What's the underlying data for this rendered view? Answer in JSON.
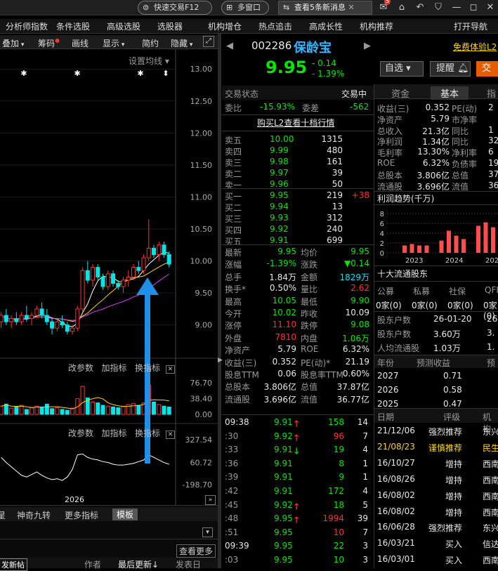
{
  "topbar": {
    "quick_trade": "快速交易F12",
    "multi_window": "多窗口",
    "news_tab": "查看5条新消息",
    "mail_badge": "5"
  },
  "menubar": {
    "items": [
      "分析师指数",
      "条件选股",
      "高级选股",
      "选股器",
      "机构增仓",
      "热点追击",
      "高成长性",
      "机构推荐",
      "打开导航"
    ]
  },
  "chartbar": {
    "items": [
      "叠加",
      "筹码",
      "画线",
      "显示",
      "简约",
      "隐藏"
    ],
    "ma_setting": "设置均线"
  },
  "chart": {
    "price_axis": [
      "13.00",
      "12.50",
      "12.00",
      "11.50",
      "11.00",
      "10.50",
      "10.00",
      "9.50",
      "9.00"
    ],
    "vol_panel": {
      "buttons": [
        "改参数",
        "加指标",
        "换指标"
      ],
      "axis": [
        "76.70",
        "38.40",
        "0.00"
      ]
    },
    "osc_panel": {
      "buttons": [
        "改参数",
        "加指标",
        "换指标"
      ],
      "axis": [
        "327.54",
        "60.72",
        "-198.70"
      ]
    },
    "x_label": "2026",
    "bottom_tabs": [
      "神奇九转",
      "更多指标",
      "模板"
    ]
  },
  "stock": {
    "code": "002286",
    "name": "保龄宝",
    "price": "9.95",
    "change": "- 0.14",
    "change_pct": "- 1.39%",
    "free_exp": "免费体验L2"
  },
  "actions": {
    "watch": "自选",
    "alert": "提醒",
    "trade": "交"
  },
  "quote": {
    "status_label": "交易状态",
    "status_value": "交易中",
    "weibi_label": "委比",
    "weibi": "-15.93%",
    "weicha_label": "委差",
    "weicha": "-562",
    "l2_link": "购买L2查看十档行情",
    "asks": [
      {
        "l": "卖五",
        "p": "10.00",
        "v": "1315"
      },
      {
        "l": "卖四",
        "p": "9.99",
        "v": "480"
      },
      {
        "l": "卖三",
        "p": "9.98",
        "v": "161"
      },
      {
        "l": "卖二",
        "p": "9.97",
        "v": "39"
      },
      {
        "l": "卖一",
        "p": "9.96",
        "v": "50"
      }
    ],
    "bids": [
      {
        "l": "买一",
        "p": "9.95",
        "v": "219",
        "x": "+38"
      },
      {
        "l": "买二",
        "p": "9.94",
        "v": "13",
        "x": ""
      },
      {
        "l": "买三",
        "p": "9.93",
        "v": "312",
        "x": ""
      },
      {
        "l": "买四",
        "p": "9.92",
        "v": "240",
        "x": ""
      },
      {
        "l": "买五",
        "p": "9.91",
        "v": "699",
        "x": ""
      }
    ],
    "stats": [
      {
        "l1": "最新",
        "v1": "9.95",
        "c1": "g",
        "l2": "均价",
        "v2": "9.95",
        "c2": "g"
      },
      {
        "l1": "涨幅",
        "v1": "-1.39%",
        "c1": "g",
        "l2": "涨跌",
        "v2": "▼0.14",
        "c2": "g"
      },
      {
        "l1": "总手",
        "v1": "1.84万",
        "c1": "w",
        "l2": "金额",
        "v2": "1829万",
        "c2": "c"
      },
      {
        "l1": "换手*",
        "v1": "0.50%",
        "c1": "w",
        "l2": "量比",
        "v2": "2.62",
        "c2": "r"
      },
      {
        "l1": "最高",
        "v1": "10.05",
        "c1": "g",
        "l2": "最低",
        "v2": "9.90",
        "c2": "g"
      },
      {
        "l1": "今开",
        "v1": "10.02",
        "c1": "g",
        "l2": "昨收",
        "v2": "10.09",
        "c2": "w"
      },
      {
        "l1": "涨停",
        "v1": "11.10",
        "c1": "r",
        "l2": "跌停",
        "v2": "9.08",
        "c2": "g"
      },
      {
        "l1": "外盘",
        "v1": "7810",
        "c1": "r",
        "l2": "内盘",
        "v2": "1.06万",
        "c2": "g"
      },
      {
        "l1": "净资产",
        "v1": "5.79",
        "c1": "w",
        "l2": "ROE",
        "v2": "6.32%",
        "c2": "w"
      },
      {
        "l1": "收益(三)",
        "v1": "0.352",
        "c1": "w",
        "l2": "PE(动)*",
        "v2": "21.19",
        "c2": "w"
      },
      {
        "l1": "股息TTM",
        "v1": "0.06",
        "c1": "w",
        "l2": "股息率TTM",
        "v2": "0.60%",
        "c2": "w"
      },
      {
        "l1": "总股本",
        "v1": "3.806亿",
        "c1": "w",
        "l2": "总值",
        "v2": "37.87亿",
        "c2": "w"
      },
      {
        "l1": "流通股",
        "v1": "3.696亿",
        "c1": "w",
        "l2": "流值",
        "v2": "36.77亿",
        "c2": "w"
      }
    ]
  },
  "ticks": [
    {
      "t": "09:38",
      "p": "9.91",
      "a": "up",
      "v": "158",
      "n": "14",
      "vc": "g"
    },
    {
      "t": ":30",
      "p": "9.92",
      "a": "up",
      "v": "96",
      "n": "7",
      "vc": "r"
    },
    {
      "t": ":33",
      "p": "9.91",
      "a": "down",
      "v": "19",
      "n": "4",
      "vc": "g"
    },
    {
      "t": ":36",
      "p": "9.91",
      "a": "",
      "v": "8",
      "n": "1",
      "vc": "g"
    },
    {
      "t": ":39",
      "p": "9.91",
      "a": "",
      "v": "9",
      "n": "1",
      "vc": "g"
    },
    {
      "t": ":42",
      "p": "9.91",
      "a": "",
      "v": "172",
      "n": "4",
      "vc": "g"
    },
    {
      "t": ":45",
      "p": "9.92",
      "a": "up",
      "v": "18",
      "n": "5",
      "vc": "g"
    },
    {
      "t": ":48",
      "p": "9.95",
      "a": "up",
      "v": "1994",
      "n": "39",
      "vc": "r"
    },
    {
      "t": ":51",
      "p": "9.95",
      "a": "",
      "v": "10",
      "n": "7",
      "vc": "r"
    },
    {
      "t": "09:39",
      "p": "9.95",
      "a": "",
      "v": "22",
      "n": "3",
      "vc": "g"
    },
    {
      "t": ":03",
      "p": "9.95",
      "a": "",
      "v": "10",
      "n": "3",
      "vc": "g"
    }
  ],
  "right": {
    "tabs": [
      "资金",
      "基本",
      "指"
    ],
    "fund": [
      {
        "l": "收益(三)",
        "v": "0.352",
        "l2": "PE(动)",
        "v2": "2"
      },
      {
        "l": "净资产",
        "v": "5.79",
        "l2": "市净率",
        "v2": ""
      },
      {
        "l": "总收入",
        "v": "21.3亿",
        "l2": "同比",
        "v2": "1"
      },
      {
        "l": "净利润",
        "v": "1.34亿",
        "l2": "同比",
        "v2": "32"
      },
      {
        "l": "毛利率",
        "v": "13.30%",
        "l2": "净利率",
        "v2": "6"
      },
      {
        "l": "ROE",
        "v": "6.32%",
        "l2": "负债率",
        "v2": "19"
      },
      {
        "l": "总股本",
        "v": "3.806亿",
        "l2": "总值",
        "v2": "37."
      },
      {
        "l": "流通股",
        "v": "3.696亿",
        "l2": "流值",
        "v2": "36."
      }
    ],
    "profit_title": "利润趋势(千万)",
    "profit_axis": [
      "8",
      "6",
      "4",
      "2",
      "0"
    ],
    "profit_years": [
      "2023",
      "2024",
      "2025"
    ],
    "holders_title": "十大流通股东",
    "holders_cols": [
      "公募",
      "私募",
      "社保",
      "QFII"
    ],
    "holders_vals": [
      "0家(0)",
      "0家(0)",
      "0家(0)",
      "0家(0)"
    ],
    "holder_rows": [
      {
        "l": "股东户数",
        "v": "26-01-20",
        "v2": "26-0"
      },
      {
        "l": "股东户数",
        "v": "3.60万",
        "v2": "3."
      },
      {
        "l": "人均流通股",
        "v": "1.03万",
        "v2": "1."
      }
    ],
    "forecast_cols": [
      "年份",
      "预测收益",
      "预"
    ],
    "forecast": [
      {
        "y": "2027",
        "v": "0.71"
      },
      {
        "y": "2026",
        "v": "0.58"
      },
      {
        "y": "2025",
        "v": "0.47"
      }
    ],
    "rating_cols": [
      "日期",
      "评级",
      "机构"
    ],
    "ratings": [
      {
        "d": "21/12/06",
        "r": "强烈推荐",
        "o": "东兴",
        "hl": false
      },
      {
        "d": "21/08/23",
        "r": "谨慎推荐",
        "o": "民生",
        "hl": true
      },
      {
        "d": "16/10/27",
        "r": "增持",
        "o": "西南",
        "hl": false
      },
      {
        "d": "16/08/26",
        "r": "增持",
        "o": "西南",
        "hl": false
      },
      {
        "d": "16/08/02",
        "r": "增持",
        "o": "西南",
        "hl": false
      },
      {
        "d": "16/08/02",
        "r": "增持",
        "o": "西南",
        "hl": false
      },
      {
        "d": "16/06/28",
        "r": "强烈推荐",
        "o": "东兴",
        "hl": false
      },
      {
        "d": "16/03/21",
        "r": "买入",
        "o": "信达",
        "hl": false
      },
      {
        "d": "16/03/01",
        "r": "买入",
        "o": "西南",
        "hl": false
      }
    ]
  },
  "bottom": {
    "more": "查看更多",
    "cols": [
      "发新帖",
      "作者",
      "最后更新",
      "发表日"
    ]
  },
  "chart_data": {
    "type": "candlestick",
    "ylim": [
      8.7,
      13.2
    ],
    "candles": [
      [
        9.05,
        9.2,
        8.95,
        9.15
      ],
      [
        9.15,
        9.25,
        9.0,
        9.05
      ],
      [
        9.05,
        9.15,
        8.95,
        9.1
      ],
      [
        9.1,
        9.2,
        9.0,
        9.05
      ],
      [
        9.05,
        9.2,
        9.0,
        9.15
      ],
      [
        9.15,
        9.3,
        9.05,
        9.1
      ],
      [
        9.1,
        9.2,
        9.0,
        9.15
      ],
      [
        9.15,
        9.3,
        9.1,
        9.25
      ],
      [
        9.25,
        9.35,
        9.1,
        9.15
      ],
      [
        9.15,
        9.25,
        9.0,
        9.05
      ],
      [
        9.05,
        9.1,
        8.85,
        8.95
      ],
      [
        8.95,
        9.1,
        8.9,
        9.05
      ],
      [
        9.05,
        9.15,
        8.95,
        9.0
      ],
      [
        9.0,
        9.05,
        8.85,
        8.9
      ],
      [
        8.9,
        9.0,
        8.85,
        8.95
      ],
      [
        8.95,
        9.3,
        8.9,
        9.25
      ],
      [
        9.25,
        9.9,
        9.2,
        9.85
      ],
      [
        9.85,
        10.0,
        9.65,
        9.7
      ],
      [
        9.7,
        9.95,
        9.6,
        9.9
      ],
      [
        9.9,
        9.95,
        9.7,
        9.75
      ],
      [
        9.75,
        9.8,
        9.55,
        9.6
      ],
      [
        9.6,
        9.85,
        9.55,
        9.8
      ],
      [
        9.8,
        9.85,
        9.6,
        9.65
      ],
      [
        9.65,
        9.7,
        9.55,
        9.6
      ],
      [
        9.6,
        9.75,
        9.5,
        9.7
      ],
      [
        9.7,
        9.85,
        9.6,
        9.75
      ],
      [
        9.75,
        9.95,
        9.7,
        9.9
      ],
      [
        9.9,
        10.0,
        9.8,
        9.85
      ],
      [
        9.85,
        10.1,
        9.8,
        10.05
      ],
      [
        10.05,
        10.65,
        10.0,
        10.2
      ],
      [
        10.2,
        10.25,
        10.05,
        10.1
      ],
      [
        10.1,
        10.3,
        10.0,
        10.25
      ],
      [
        10.25,
        10.3,
        10.05,
        10.1
      ],
      [
        10.1,
        10.15,
        9.9,
        9.95
      ]
    ],
    "volumes": [
      20,
      25,
      15,
      18,
      22,
      12,
      16,
      20,
      18,
      25,
      14,
      16,
      12,
      10,
      15,
      38,
      68,
      40,
      30,
      28,
      22,
      20,
      18,
      16,
      20,
      24,
      26,
      22,
      28,
      72,
      30,
      24,
      20,
      18
    ],
    "osc": [
      120,
      60,
      10,
      -40,
      -90,
      -110,
      -80,
      -50,
      -90,
      -120,
      -140,
      -130,
      -150,
      -110,
      -20,
      150,
      160,
      120,
      100,
      90,
      70,
      60,
      40,
      30,
      30,
      40,
      50,
      70,
      90,
      150,
      120,
      90,
      60,
      40
    ]
  }
}
